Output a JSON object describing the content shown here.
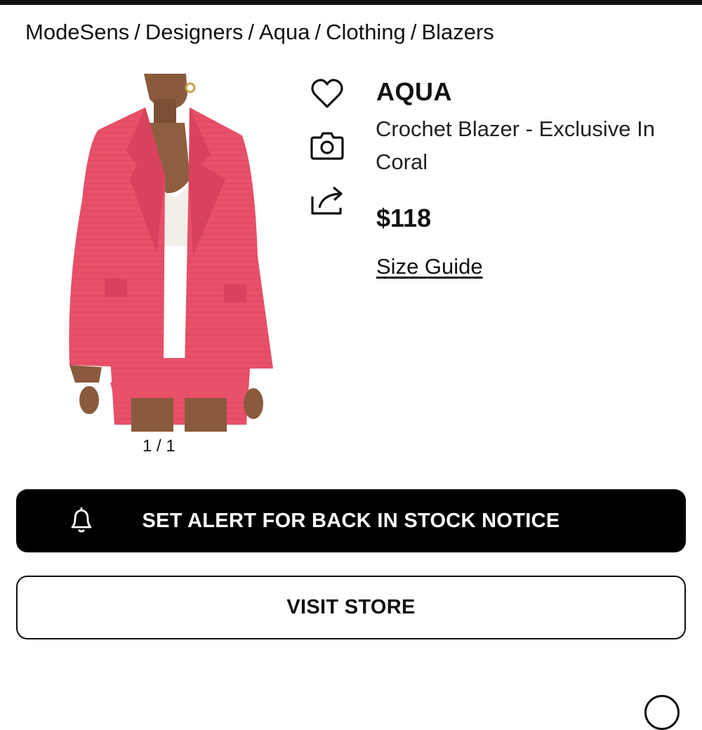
{
  "breadcrumb": {
    "items": [
      "ModeSens",
      "Designers",
      "Aqua",
      "Clothing",
      "Blazers"
    ],
    "separator": "/"
  },
  "product": {
    "brand": "AQUA",
    "name": "Crochet Blazer - Exclusive In Coral",
    "price": "$118",
    "size_guide_label": "Size Guide",
    "image_counter": "1 / 1"
  },
  "actions": {
    "alert_label": "SET ALERT FOR BACK IN STOCK NOTICE",
    "visit_label": "VISIT STORE"
  },
  "icons": {
    "wishlist": "heart-icon",
    "camera": "camera-icon",
    "share": "share-icon",
    "alert": "bell-icon"
  },
  "colors": {
    "blazer": "#e9506a",
    "button_bg": "#000000"
  }
}
